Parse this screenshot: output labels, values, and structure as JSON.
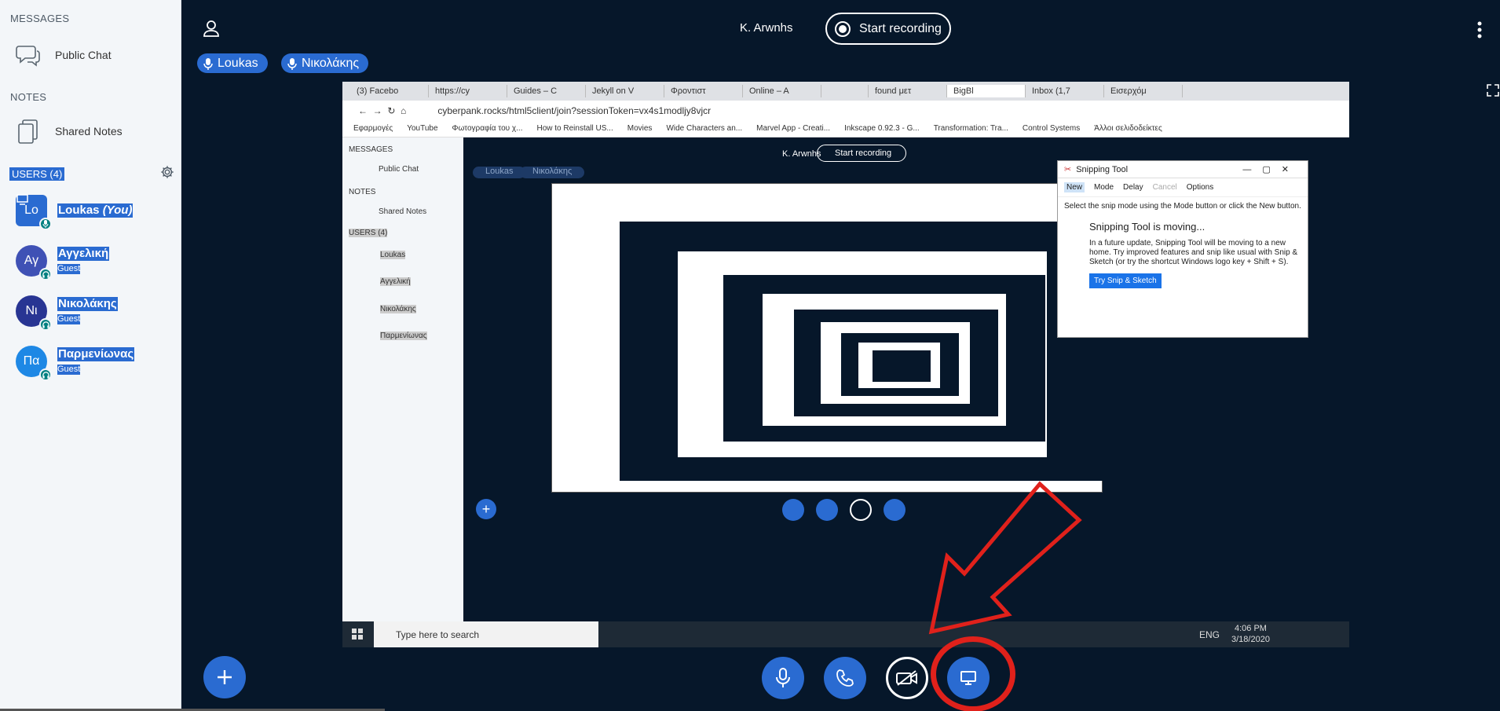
{
  "sidebar": {
    "messages_heading": "MESSAGES",
    "public_chat": "Public Chat",
    "notes_heading": "NOTES",
    "shared_notes": "Shared Notes",
    "users_heading": "USERS (4)",
    "users": [
      {
        "initials": "Lo",
        "name": "Loukas",
        "you": "(You)",
        "role": "",
        "color": "#2A6BD1"
      },
      {
        "initials": "Αγ",
        "name": "Αγγελική",
        "role": "Guest",
        "color": "#3F51B5"
      },
      {
        "initials": "Νι",
        "name": "Νικολάκης",
        "role": "Guest",
        "color": "#283593"
      },
      {
        "initials": "Πα",
        "name": "Παρμενίωνας",
        "role": "Guest",
        "color": "#1E88E5"
      }
    ]
  },
  "topbar": {
    "presenter": "K. Arwnhs",
    "record_label": "Start recording"
  },
  "talkers": [
    "Loukas",
    "Νικολάκης"
  ],
  "screenshot": {
    "tabs": [
      "(3) Facebo",
      "https://cy",
      "Guides – C",
      "Jekyll on V",
      "Φροντιστ",
      "Online – A",
      "",
      "found μετ",
      "BigBl",
      "Inbox (1,7",
      "Εισερχόμ"
    ],
    "url": "cyberpank.rocks/html5client/join?sessionToken=vx4s1modljy8vjcr",
    "bookmarks": [
      "Εφαρμογές",
      "YouTube",
      "Φωτογραφία του χ...",
      "How to Reinstall US...",
      "Movies",
      "Wide Characters an...",
      "Marvel App - Creati...",
      "Inkscape 0.92.3 - G...",
      "Transformation: Tra...",
      "Control Systems",
      "Άλλοι σελιδοδείκτες"
    ],
    "taskbar_search": "Type here to search",
    "clock_time": "4:06 PM",
    "clock_date": "3/18/2020",
    "lang": "ENG",
    "snipping": {
      "title": "Snipping Tool",
      "new": "New",
      "mode": "Mode",
      "delay": "Delay",
      "cancel": "Cancel",
      "options": "Options",
      "instruction": "Select the snip mode using the Mode button or click the New button.",
      "moving_title": "Snipping Tool is moving...",
      "moving_desc": "In a future update, Snipping Tool will be moving to a new home. Try improved features and snip like usual with Snip & Sketch (or try the shortcut Windows logo key + Shift + S).",
      "try_button": "Try Snip & Sketch"
    }
  },
  "colors": {
    "accent": "#2A6BD1",
    "background": "#06172A",
    "highlight": "#E0211B"
  }
}
